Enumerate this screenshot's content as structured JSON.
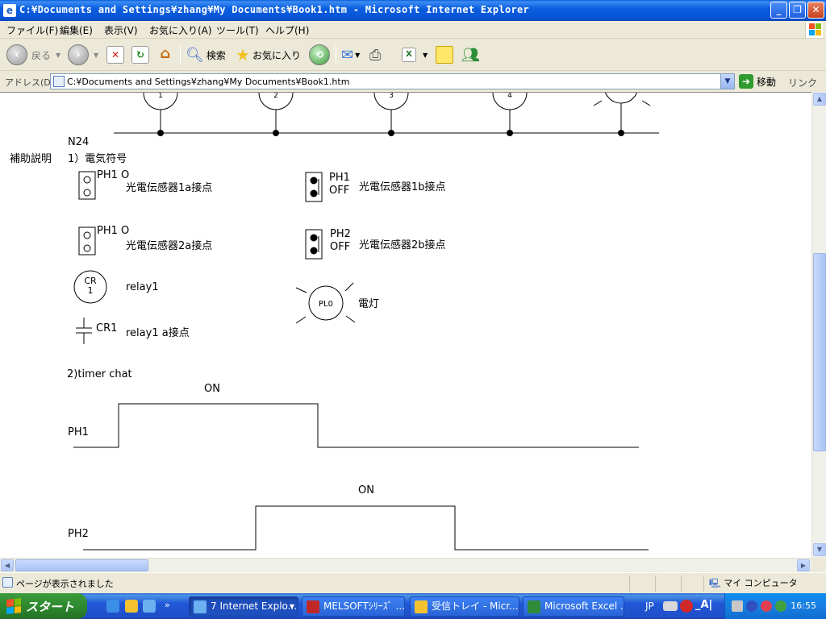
{
  "window": {
    "title": "C:¥Documents and Settings¥zhang¥My Documents¥Book1.htm - Microsoft Internet Explorer",
    "controls": {
      "minimize": "_",
      "maximize": "❐",
      "close": "✕"
    }
  },
  "menu": [
    "ファイル(F)",
    "編集(E)",
    "表示(V)",
    "お気に入り(A)",
    "ツール(T)",
    "ヘルプ(H)"
  ],
  "toolbar": {
    "back_label": "戻る",
    "search_label": "検索",
    "favorites_label": "お気に入り"
  },
  "address": {
    "label": "アドレス(D)",
    "value": "C:¥Documents and Settings¥zhang¥My Documents¥Book1.htm",
    "go_label": "移動",
    "links_label": "リンク"
  },
  "diagram": {
    "top_labels": [
      "1",
      "2",
      "3",
      "4"
    ],
    "bus_label": "N24",
    "section_label": "補助説明",
    "section1_title": "1）電気符号",
    "ph1_a_symbol": "PH1 O",
    "ph1_a_desc": "光電伝感器1a接点",
    "ph1_b_symbol_1": "PH1",
    "ph1_b_symbol_2": "OFF",
    "ph1_b_desc": "光電伝感器1b接点",
    "ph2_a_symbol": "PH1 O",
    "ph2_a_desc": "光電伝感器2a接点",
    "ph2_b_symbol_1": "PH2",
    "ph2_b_symbol_2": "OFF",
    "ph2_b_desc": "光電伝感器2b接点",
    "relay_symbol_1": "CR",
    "relay_symbol_2": "1",
    "relay_desc": "relay1",
    "lamp_symbol": "PL0",
    "lamp_desc": "電灯",
    "contact_symbol": "CR1",
    "contact_desc": "relay1  a接点",
    "section2_title": "2)timer chat",
    "ph1_on": "ON",
    "ph1_label": "PH1",
    "ph2_on": "ON",
    "ph2_label": "PH2"
  },
  "status": {
    "message": "ページが表示されました",
    "zone": "マイ コンピュータ"
  },
  "taskbar": {
    "start": "スタート",
    "tasks": [
      "7 Internet Explo...",
      "MELSOFTｼﾘｰｽﾞ ...",
      "受信トレイ - Micr...",
      "Microsoft Excel ..."
    ],
    "lang": "JP",
    "clock": "16:55"
  }
}
